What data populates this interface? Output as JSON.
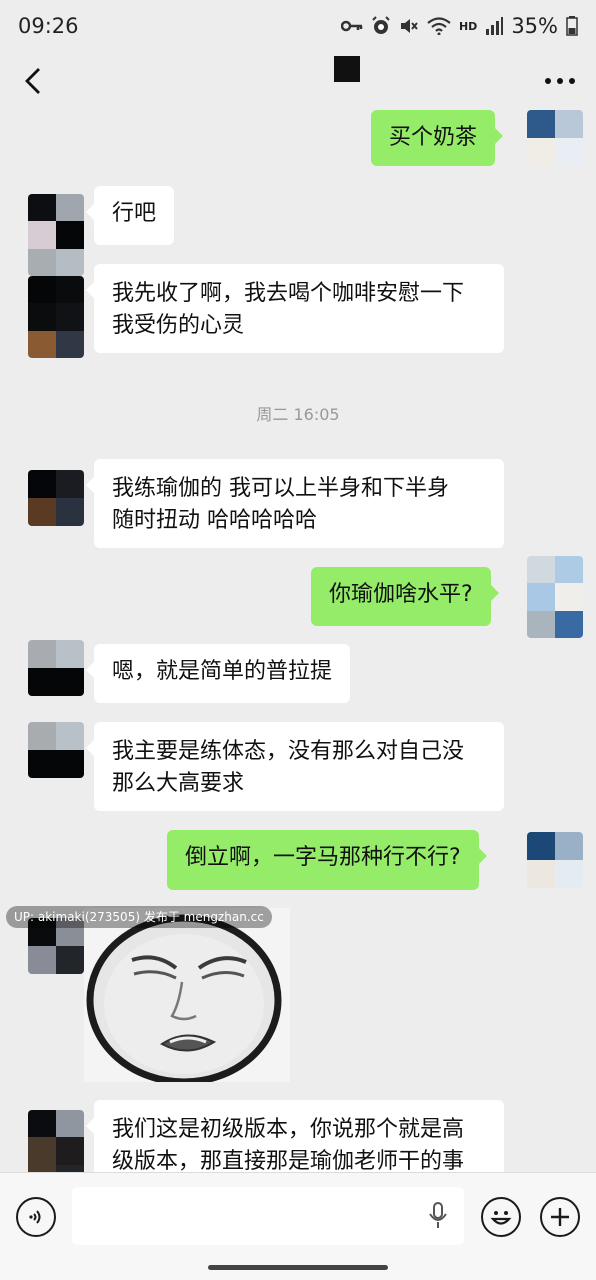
{
  "status_bar": {
    "time": "09:26",
    "battery": "35%",
    "network_label": "HD",
    "icons": [
      "key-icon",
      "alarm-icon",
      "mute-icon",
      "wifi-icon",
      "signal-icon",
      "battery-icon"
    ]
  },
  "nav": {
    "back_icon": "chevron-left-icon",
    "more_icon": "more-icon"
  },
  "messages": [
    {
      "side": "out",
      "text": "买个奶茶"
    },
    {
      "side": "in",
      "text": "行吧"
    },
    {
      "side": "in",
      "text": "我先收了啊，我去喝个咖啡安慰一下\n我受伤的心灵"
    },
    {
      "type": "time",
      "text": "周二 16:05"
    },
    {
      "side": "in",
      "text": "我练瑜伽的 我可以上半身和下半身\n随时扭动 哈哈哈哈哈"
    },
    {
      "side": "out",
      "text": "你瑜伽啥水平?"
    },
    {
      "side": "in",
      "text": "嗯，就是简单的普拉提"
    },
    {
      "side": "in",
      "text": "我主要是练体态，没有那么对自己没\n那么大高要求"
    },
    {
      "side": "out",
      "text": "倒立啊，一字马那种行不行?"
    },
    {
      "side": "in",
      "type": "sticker",
      "sticker": "meme-face-sticker"
    },
    {
      "side": "in",
      "text": "我们这是初级版本，你说那个就是高\n级版本，那直接那是瑜伽老师干的事"
    }
  ],
  "watermark": "UP: akimaki(273505) 发布于 mengzhan.cc",
  "input_bar": {
    "voice_icon": "voice-icon",
    "mic_icon": "microphone-icon",
    "emoji_icon": "emoji-icon",
    "plus_icon": "plus-icon"
  },
  "colors": {
    "background": "#ededed",
    "incoming_bubble": "#ffffff",
    "outgoing_bubble": "#95ec69",
    "timestamp": "#999999"
  }
}
